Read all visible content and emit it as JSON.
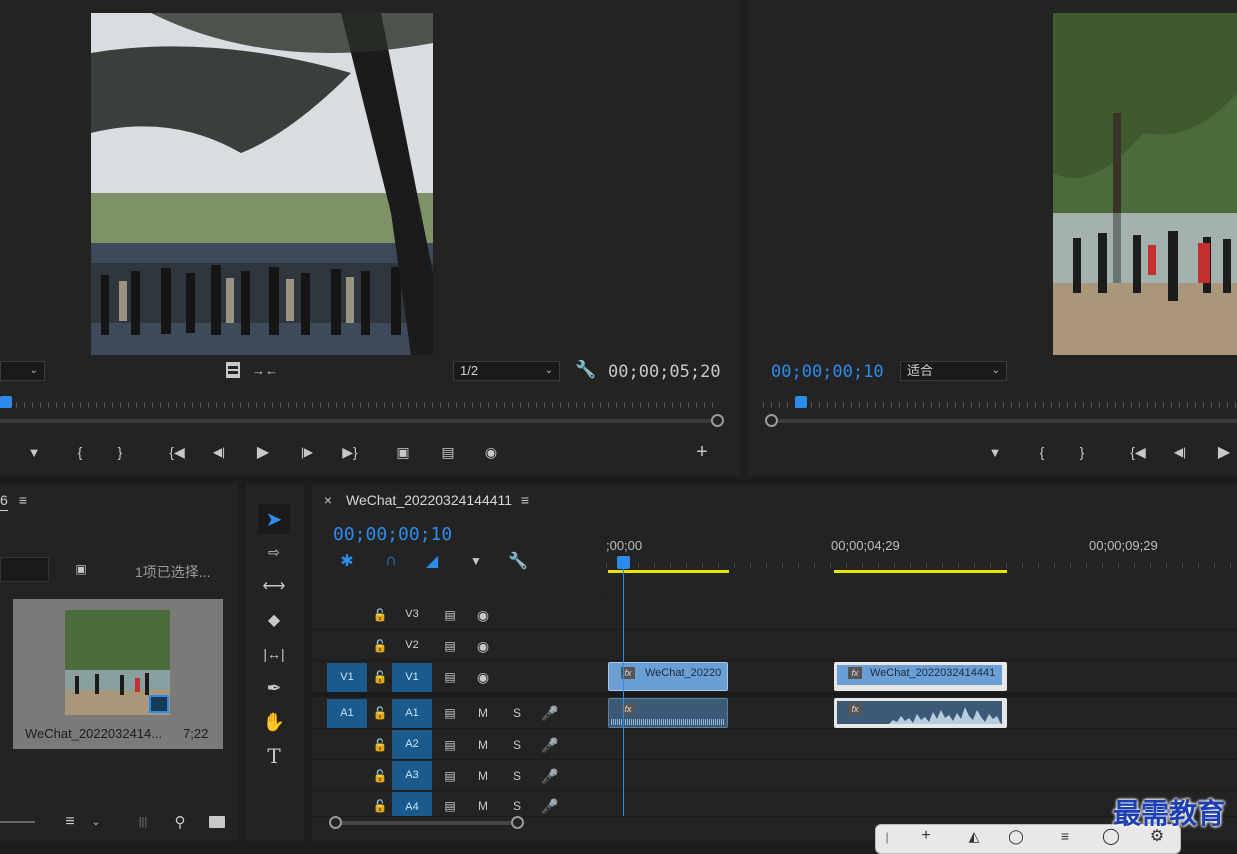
{
  "source_monitor": {
    "fit_dropdown_value": "",
    "resolution_value": "1/2",
    "timecode": "00;00;05;20"
  },
  "program_monitor": {
    "timecode": "00;00;00;10",
    "fit_value": "适合"
  },
  "project_panel": {
    "tab_fragment": "6",
    "selection_status": "1项已选择...",
    "clip_name": "WeChat_2022032414...",
    "clip_duration": "7;22"
  },
  "timeline": {
    "tab_title": "WeChat_20220324144411",
    "playhead_timecode": "00;00;00;10",
    "ruler_labels": [
      ";00;00",
      "00;00;04;29",
      "00;00;09;29"
    ],
    "video_tracks": [
      {
        "source": "",
        "target": "V3"
      },
      {
        "source": "",
        "target": "V2"
      },
      {
        "source": "V1",
        "target": "V1"
      }
    ],
    "audio_tracks": [
      {
        "source": "A1",
        "target": "A1",
        "m": "M",
        "s": "S"
      },
      {
        "source": "",
        "target": "A2",
        "m": "M",
        "s": "S"
      },
      {
        "source": "",
        "target": "A3",
        "m": "M",
        "s": "S"
      },
      {
        "source": "",
        "target": "A4",
        "m": "M",
        "s": "S"
      }
    ],
    "clips": {
      "v1_clip1": "WeChat_20220",
      "v1_clip2": "WeChat_2022032414441"
    },
    "fx_label": "fx"
  },
  "tools": {
    "type_tool": "T"
  },
  "watermark": "最需教育",
  "colors": {
    "accent_blue": "#2d8ceb",
    "track_blue": "#1a5a8c",
    "clip_video": "#6a9fd6",
    "clip_audio": "#3c5a78",
    "work_area_yellow": "#e6e600"
  }
}
